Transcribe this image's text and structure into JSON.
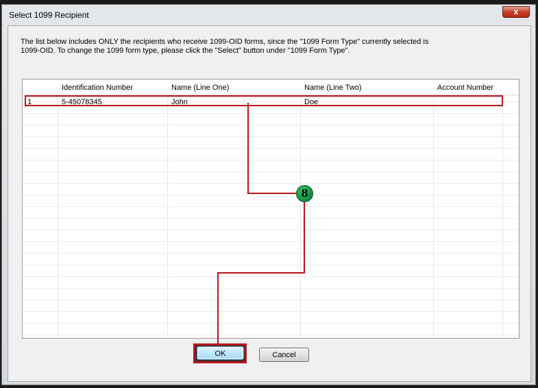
{
  "window": {
    "title": "Select 1099 Recipient",
    "close_glyph": "x"
  },
  "info_text": "The list below includes ONLY the recipients who receive 1099-OID forms, since the \"1099 Form Type\" currently selected is\n1099-OID. To change the 1099 form type, please click the \"Select\" button under \"1099 Form Type\".",
  "grid": {
    "columns": [
      "",
      "Identification Number",
      "Name (Line One)",
      "Name (Line Two)",
      "Account Number"
    ],
    "rows": [
      [
        "1",
        "5-45078345",
        "John",
        "Doe",
        ""
      ]
    ]
  },
  "buttons": {
    "ok_label": "OK",
    "cancel_label": "Cancel"
  },
  "annotation": {
    "step_number": "8",
    "highlight_color": "#b8141c",
    "badge_color": "#1aa34a"
  }
}
